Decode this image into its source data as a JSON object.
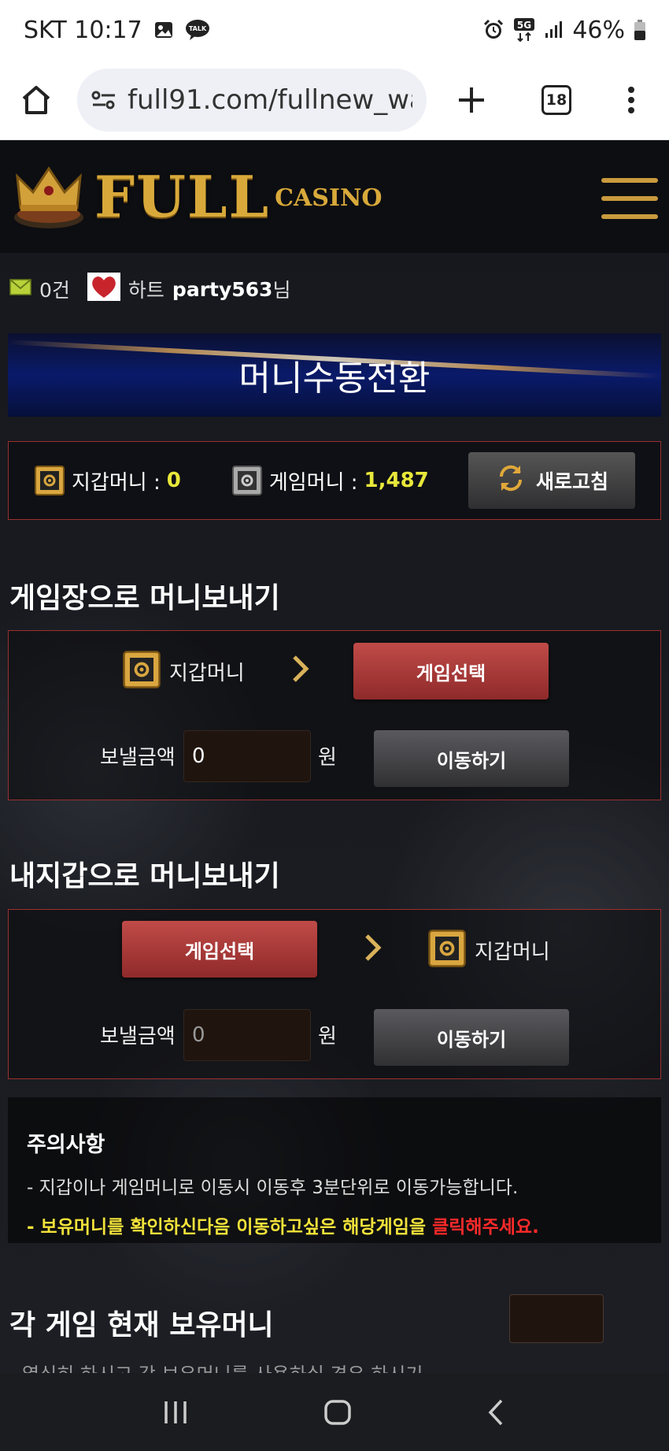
{
  "status_bar": {
    "carrier_time": "SKT 10:17",
    "network": "5G",
    "battery": "46%"
  },
  "browser": {
    "url": "full91.com/fullnew_wa",
    "tab_count": "18"
  },
  "site": {
    "logo_main": "FULL",
    "logo_sub": "CASINO",
    "message_count": "0건",
    "user_prefix": "하트",
    "username": "party563",
    "user_suffix": "님"
  },
  "banner": {
    "title": "머니수동전환"
  },
  "balances": {
    "wallet_label": "지갑머니 : ",
    "wallet_value": "0",
    "game_label": "게임머니 : ",
    "game_value": "1,487",
    "refresh_label": "새로고침"
  },
  "to_game": {
    "title": "게임장으로 머니보내기",
    "source_label": "지갑머니",
    "select_label": "게임선택",
    "amount_label": "보낼금액",
    "amount_value": "0",
    "unit": "원",
    "move_label": "이동하기"
  },
  "to_wallet": {
    "title": "내지갑으로 머니보내기",
    "select_label": "게임선택",
    "dest_label": "지갑머니",
    "amount_label": "보낼금액",
    "amount_placeholder": "0",
    "unit": "원",
    "move_label": "이동하기"
  },
  "notice": {
    "title": "주의사항",
    "line1": "- 지갑이나 게임머니로 이동시 이동후 3분단위로 이동가능합니다.",
    "line2_prefix": "- 보유머니를 확인하신다음 이동하고싶은 해당게임을 ",
    "line2_red": "클릭해주세요."
  },
  "holdings": {
    "title": "각 게임 현재 보유머니",
    "cut_text": "열심히 하시고 각 보유머니를 사용하실 경우 하시기"
  },
  "colors": {
    "accent_gold": "#d8a93a",
    "value_yellow": "#e8e83a",
    "button_red": "#c04b48",
    "border_red": "#9b2f2f",
    "chat_blue": "#0b6ce0"
  }
}
